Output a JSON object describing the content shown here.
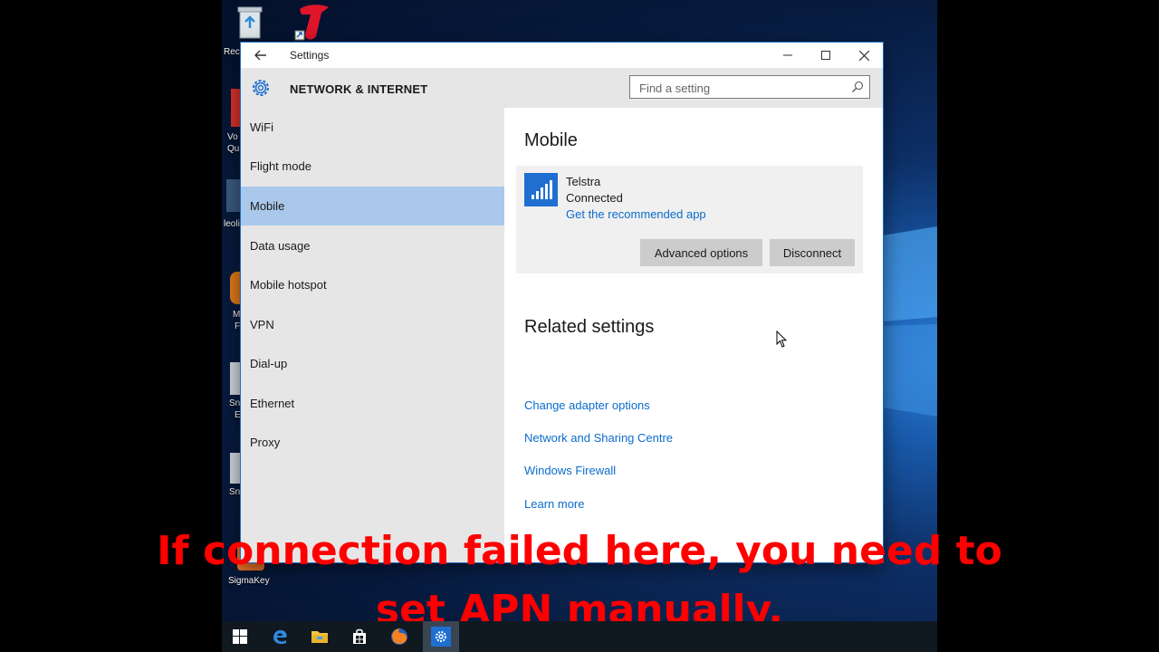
{
  "window": {
    "title": "Settings",
    "section_title": "NETWORK & INTERNET",
    "minimize_icon": "minimize-icon",
    "maximize_icon": "maximize-icon",
    "close_icon": "close-icon"
  },
  "search": {
    "placeholder": "Find a setting",
    "value": ""
  },
  "sidebar": {
    "items": [
      {
        "label": "WiFi",
        "active": false
      },
      {
        "label": "Flight mode",
        "active": false
      },
      {
        "label": "Mobile",
        "active": true
      },
      {
        "label": "Data usage",
        "active": false
      },
      {
        "label": "Mobile hotspot",
        "active": false
      },
      {
        "label": "VPN",
        "active": false
      },
      {
        "label": "Dial-up",
        "active": false
      },
      {
        "label": "Ethernet",
        "active": false
      },
      {
        "label": "Proxy",
        "active": false
      }
    ]
  },
  "main": {
    "heading": "Mobile",
    "connection": {
      "carrier": "Telstra",
      "status": "Connected",
      "link": "Get the recommended app",
      "icon": "signal-bars-icon"
    },
    "buttons": {
      "advanced": "Advanced options",
      "disconnect": "Disconnect"
    },
    "related_heading": "Related settings",
    "related_links": [
      "Change adapter options",
      "Network and Sharing Centre",
      "Windows Firewall",
      "Learn more"
    ]
  },
  "desktop": {
    "icons": [
      {
        "label": "Rec",
        "icon": "recycle-bin-icon"
      },
      {
        "label": "Vo",
        "icon": "app-shortcut-icon"
      },
      {
        "label": "Qu",
        "icon": "app-shortcut-icon"
      },
      {
        "label": "leoli",
        "icon": "app-shortcut-icon"
      },
      {
        "label": "M",
        "icon": "app-shortcut-icon"
      },
      {
        "label": "F",
        "icon": "app-shortcut-icon"
      },
      {
        "label": "Sn",
        "icon": "app-shortcut-icon"
      },
      {
        "label": "E",
        "icon": "app-shortcut-icon"
      },
      {
        "label": "Sn",
        "icon": "app-shortcut-icon"
      },
      {
        "label": "SigmaKey",
        "icon": "sigmakey-icon"
      }
    ]
  },
  "caption": {
    "line1": "If connection failed here, you need to",
    "line2": "set APN manually."
  },
  "taskbar": {
    "items": [
      "start-icon",
      "edge-icon",
      "file-explorer-icon",
      "store-icon",
      "firefox-icon",
      "settings-gear-icon"
    ]
  },
  "colors": {
    "accent": "#1f6fd0",
    "selection": "#a9c8ea",
    "link": "#0a6ccc",
    "caption": "#ff0000"
  }
}
